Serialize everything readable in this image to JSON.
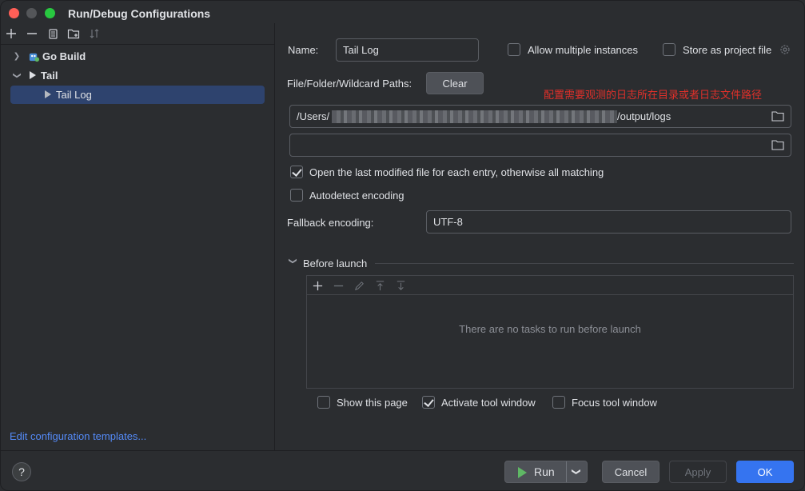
{
  "window": {
    "title": "Run/Debug Configurations"
  },
  "tree": {
    "items": [
      {
        "label": "Go Build"
      },
      {
        "label": "Tail"
      },
      {
        "label": "Tail Log"
      }
    ],
    "edit_templates": "Edit configuration templates..."
  },
  "form": {
    "name_label": "Name:",
    "name_value": "Tail Log",
    "allow_multiple_label": "Allow multiple instances",
    "store_project_label": "Store as project file",
    "paths_label": "File/Folder/Wildcard Paths:",
    "clear_label": "Clear",
    "annotation": "配置需要观测的日志所在目录或者日志文件路径",
    "path1_prefix": "/Users/",
    "path1_suffix": "/output/logs",
    "path2_value": "",
    "open_last_label": "Open the last modified file for each entry, otherwise all matching",
    "open_last_checked": true,
    "autodetect_label": "Autodetect encoding",
    "autodetect_checked": false,
    "fallback_label": "Fallback encoding:",
    "fallback_value": "UTF-8"
  },
  "before_launch": {
    "title": "Before launch",
    "empty_text": "There are no tasks to run before launch",
    "show_page_label": "Show this page",
    "activate_label": "Activate tool window",
    "focus_label": "Focus tool window"
  },
  "footer": {
    "help": "?",
    "run": "Run",
    "cancel": "Cancel",
    "apply": "Apply",
    "ok": "OK"
  },
  "colors": {
    "accent": "#3574f0",
    "annotation": "#e0302a",
    "run_green": "#5fb865",
    "link": "#548af7"
  }
}
